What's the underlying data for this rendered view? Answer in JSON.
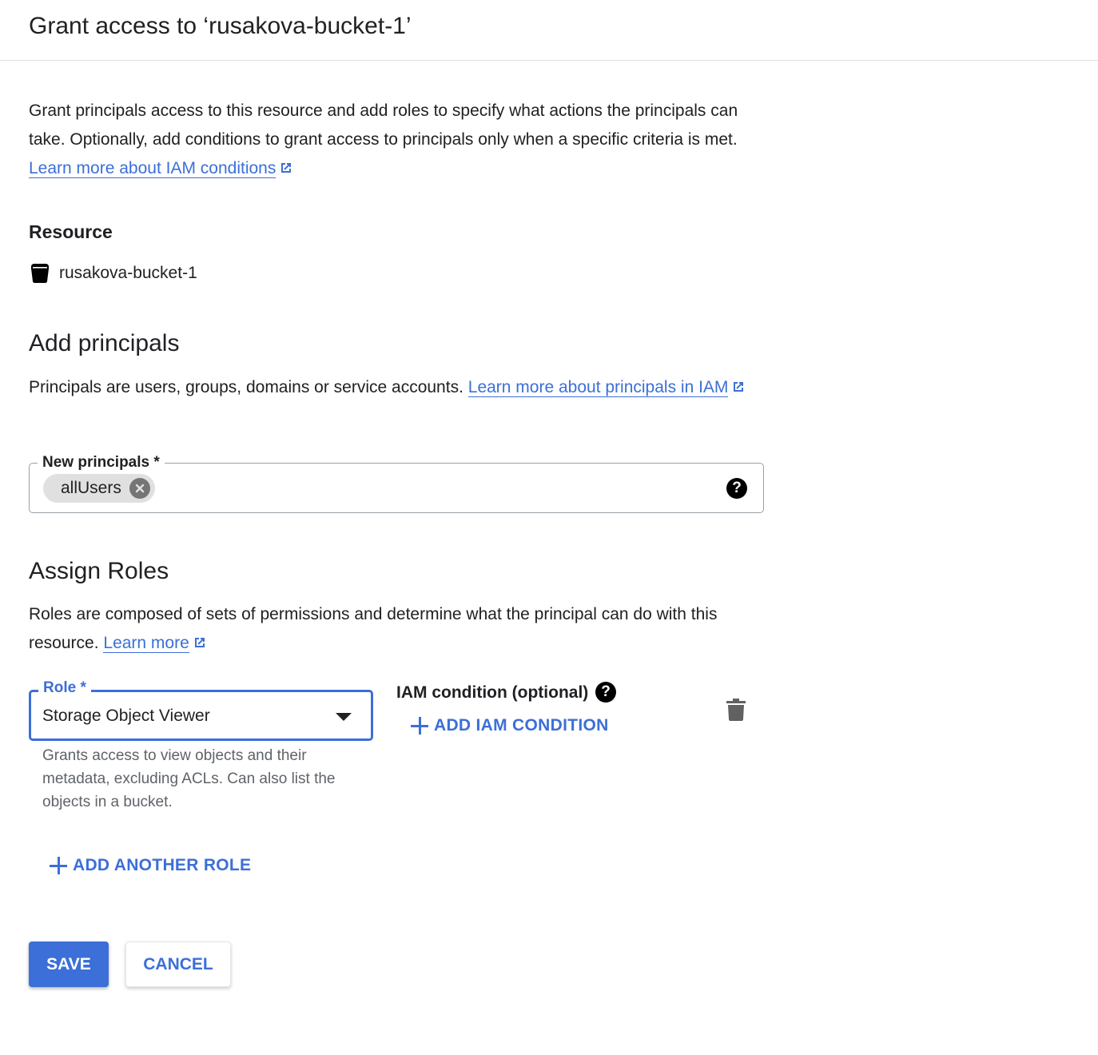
{
  "header": {
    "title": "Grant access to ‘rusakova-bucket-1’"
  },
  "intro": {
    "text": "Grant principals access to this resource and add roles to specify what actions the principals can take. Optionally, add conditions to grant access to principals only when a specific criteria is met.",
    "link": "Learn more about IAM conditions"
  },
  "resource": {
    "label": "Resource",
    "name": "rusakova-bucket-1",
    "icon": "bucket-icon"
  },
  "add_principals": {
    "title": "Add principals",
    "description": "Principals are users, groups, domains or service accounts.",
    "link": "Learn more about principals in IAM",
    "field_label": "New principals *",
    "chips": [
      "allUsers"
    ],
    "help_icon": "help-icon"
  },
  "assign_roles": {
    "title": "Assign Roles",
    "description": "Roles are composed of sets of permissions and determine what the principal can do with this resource.",
    "link": "Learn more",
    "role_label": "Role *",
    "role_value": "Storage Object Viewer",
    "role_helper": "Grants access to view objects and their metadata, excluding ACLs. Can also list the objects in a bucket.",
    "iam_condition_label": "IAM condition (optional)",
    "add_iam_condition": "ADD IAM CONDITION",
    "add_another_role": "ADD ANOTHER ROLE"
  },
  "actions": {
    "save": "SAVE",
    "cancel": "CANCEL"
  },
  "colors": {
    "accent": "#3c6fd7",
    "text": "#202124",
    "secondary_text": "#5f6368",
    "chip_bg": "#e0e0e0"
  }
}
